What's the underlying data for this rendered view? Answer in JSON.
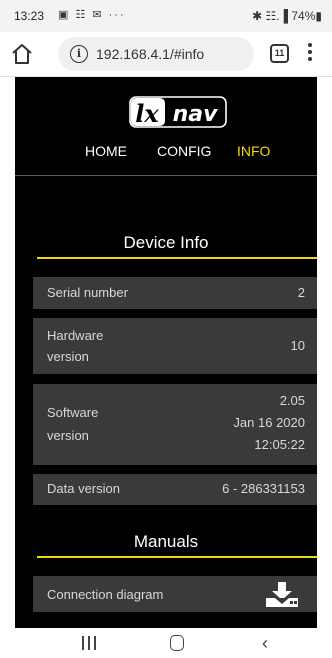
{
  "status_bar": {
    "time": "13:23",
    "left_icons": "▣ ☷ ✉ ···",
    "right_icons": "✱ ☷.▐ 74%▮"
  },
  "browser": {
    "url": "192.168.4.1/#info",
    "tab_count": "11"
  },
  "site": {
    "logo_text": "lxnav",
    "nav": {
      "home": "HOME",
      "config": "CONFIG",
      "info": "INFO"
    },
    "accent_color": "#f0dc00"
  },
  "device_info": {
    "title": "Device Info",
    "rows": [
      {
        "label": "Serial number",
        "value": "2"
      },
      {
        "label": "Hardware\nversion",
        "value": "10"
      },
      {
        "label": "Software\nversion",
        "value": "2.05\nJan 16 2020\n12:05:22"
      },
      {
        "label": "Data version",
        "value": "6 - 286331153"
      }
    ]
  },
  "manuals": {
    "title": "Manuals",
    "items": [
      {
        "label": "Connection diagram",
        "icon": "download-icon"
      }
    ]
  }
}
